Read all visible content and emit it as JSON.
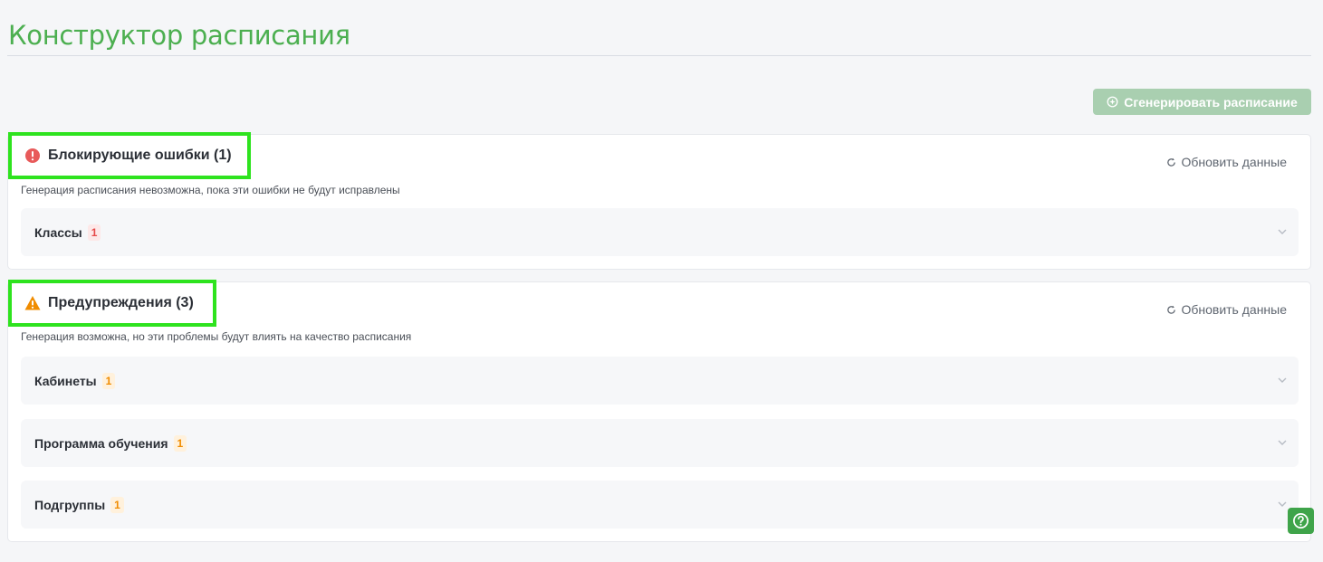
{
  "page": {
    "title": "Конструктор расписания"
  },
  "toolbar": {
    "generate_label": "Сгенерировать расписание",
    "generate_icon": "sparkle-icon"
  },
  "blocking": {
    "title": "Блокирующие ошибки (1)",
    "subtitle": "Генерация расписания невозможна, пока эти ошибки не будут исправлены",
    "refresh_label": "Обновить данные",
    "icon": "error-circle-icon",
    "color": "#e64949",
    "items": [
      {
        "label": "Классы",
        "count": "1"
      }
    ]
  },
  "warnings": {
    "title": "Предупреждения (3)",
    "subtitle": "Генерация возможна, но эти проблемы будут влиять на качество расписания",
    "refresh_label": "Обновить данные",
    "icon": "warning-triangle-icon",
    "color": "#f08c00",
    "items": [
      {
        "label": "Кабинеты",
        "count": "1"
      },
      {
        "label": "Программа обучения",
        "count": "1"
      },
      {
        "label": "Подгруппы",
        "count": "1"
      }
    ]
  },
  "colors": {
    "brand": "#4caf50",
    "highlight": "#2ee31e",
    "help_button": "#3fa44a"
  },
  "help": {
    "icon": "question-circle-icon"
  }
}
